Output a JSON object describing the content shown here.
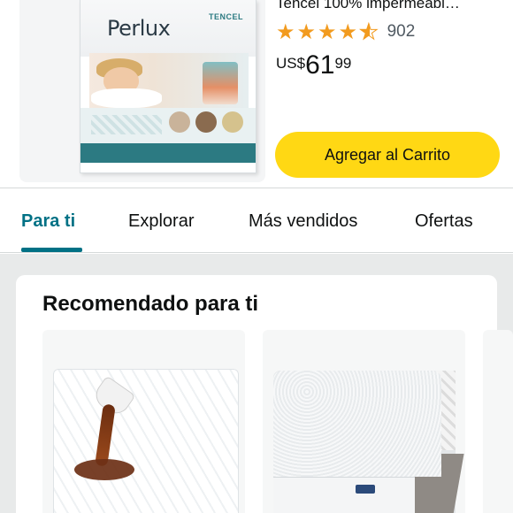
{
  "product": {
    "title": "Tencel 100% impermeabl…",
    "rating_value": 4.5,
    "rating_count": "902",
    "price_currency": "US$",
    "price_whole": "61",
    "price_fraction": "99",
    "package_brand": "Perlux",
    "package_badge": "TENCEL",
    "add_to_cart_label": "Agregar al Carrito"
  },
  "tabs": [
    {
      "label": "Para ti",
      "active": true
    },
    {
      "label": "Explorar",
      "active": false
    },
    {
      "label": "Más vendidos",
      "active": false
    },
    {
      "label": "Ofertas",
      "active": false
    }
  ],
  "recommendations": {
    "title": "Recomendado para ti"
  },
  "colors": {
    "accent": "#007185",
    "button": "#ffd814",
    "stars": "#f29b1f",
    "feed_background": "#e8eaea"
  },
  "icons": {
    "star_full": "star-icon",
    "star_half": "star-half-icon"
  }
}
